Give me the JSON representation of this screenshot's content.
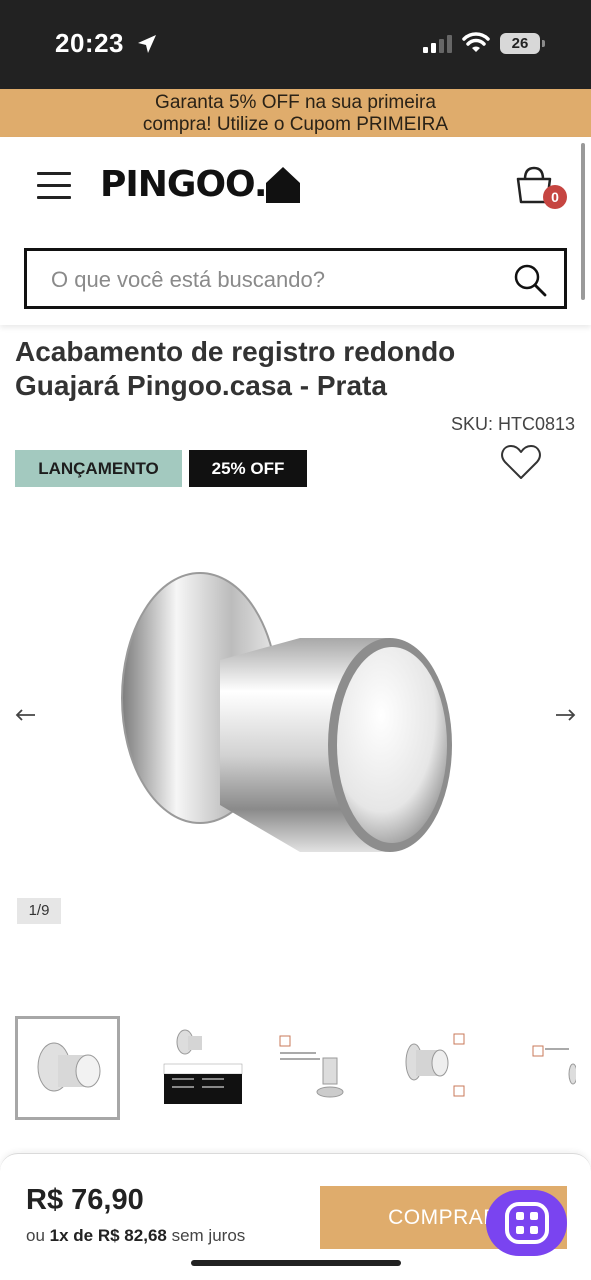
{
  "status_bar": {
    "time": "20:23",
    "battery": "26",
    "location_icon": "location-arrow-icon",
    "signal_icon": "cellular-signal-icon",
    "wifi_icon": "wifi-icon"
  },
  "promo": {
    "line1": "Garanta 5% OFF na sua primeira",
    "line2": "compra! Utilize o Cupom PRIMEIRA",
    "color": "#dfac6c"
  },
  "header": {
    "logo": "PINGOO.",
    "cart_count": "0",
    "menu_icon": "hamburger-menu-icon",
    "cart_icon": "shopping-bag-icon"
  },
  "search": {
    "placeholder": "O que você está buscando?",
    "value": ""
  },
  "product": {
    "title_line1": "Acabamento de registro redondo",
    "title_line2": "Guajará Pingoo.casa - Prata",
    "sku": "SKU: HTC0813",
    "badge_new": "LANÇAMENTO",
    "badge_discount": "25% OFF",
    "image_counter": "1/9"
  },
  "gallery": {
    "thumbnail_count": 5,
    "active_index": 0
  },
  "purchase": {
    "price": "R$ 76,90",
    "installment_prefix": "ou",
    "installment_highlight": "1x de R$ 82,68",
    "installment_suffix": "sem juros",
    "buy_label": "COMPRAR",
    "accent_color": "#dfac6c",
    "chat_color": "#7a44f0"
  }
}
